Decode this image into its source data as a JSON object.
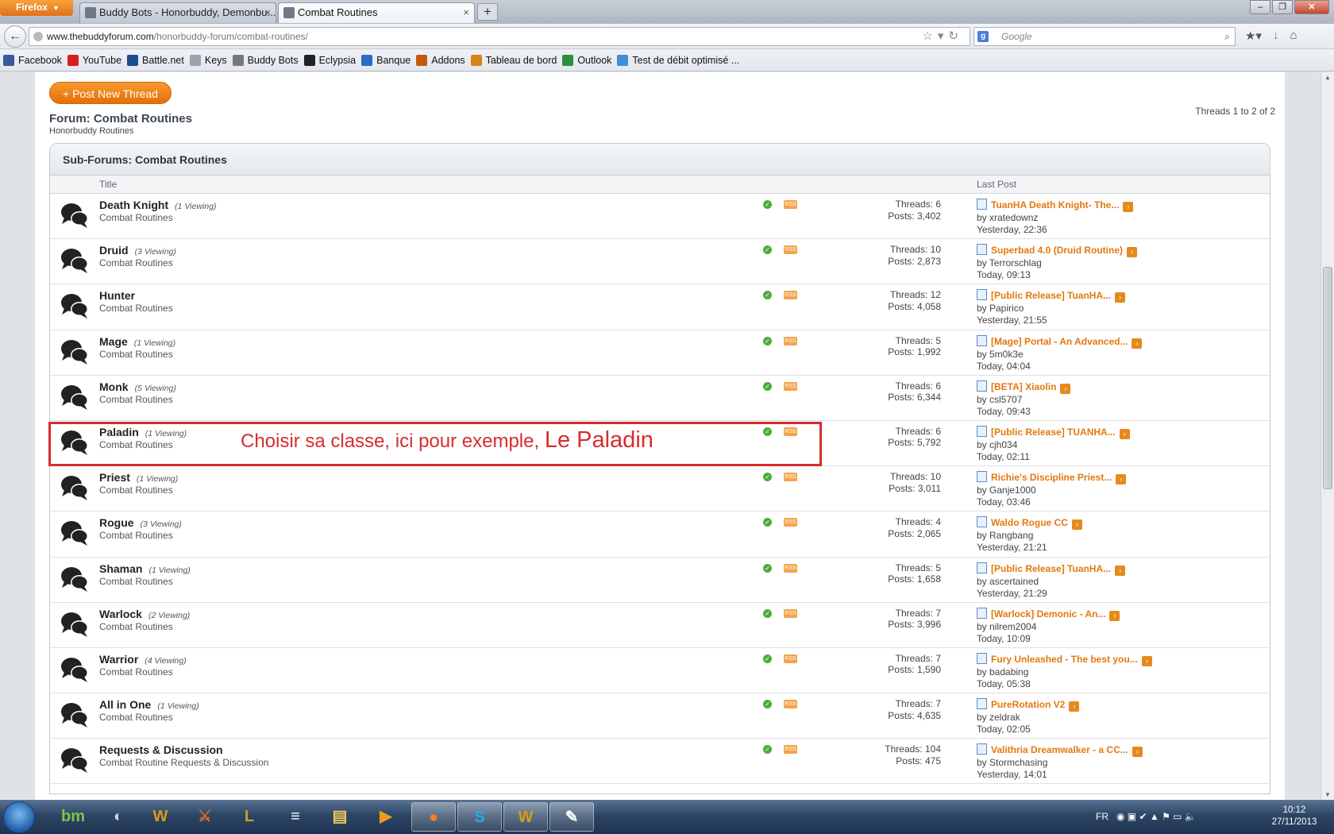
{
  "browser": {
    "menu_label": "Firefox",
    "tabs": [
      {
        "label": "Buddy Bots - Honorbuddy, Demonbu..."
      },
      {
        "label": "Combat Routines"
      }
    ],
    "url_host": "www.thebuddyforum.com",
    "url_path": "/honorbuddy-forum/combat-routines/",
    "search_placeholder": "Google",
    "bookmarks": [
      {
        "label": "Facebook",
        "color": "#3b5998"
      },
      {
        "label": "YouTube",
        "color": "#d81f1f"
      },
      {
        "label": "Battle.net",
        "color": "#1e4d8c"
      },
      {
        "label": "Keys",
        "color": "#9aa3ae"
      },
      {
        "label": "Buddy Bots",
        "color": "#777777"
      },
      {
        "label": "Eclypsia",
        "color": "#222222"
      },
      {
        "label": "Banque",
        "color": "#2a6bc9"
      },
      {
        "label": "Addons",
        "color": "#c25b10"
      },
      {
        "label": "Tableau de bord",
        "color": "#d8821b"
      },
      {
        "label": "Outlook",
        "color": "#2d8f3a"
      },
      {
        "label": "Test de débit optimisé ...",
        "color": "#3c8ed6"
      }
    ]
  },
  "page": {
    "post_button": "+ Post New Thread",
    "forum_title": "Forum: Combat Routines",
    "forum_subtitle": "Honorbuddy Routines",
    "thread_count": "Threads 1 to 2 of 2",
    "subforum_header": "Sub-Forums: Combat Routines",
    "col_title": "Title",
    "col_last_post": "Last Post",
    "annotation": "Choisir sa classe, ici pour exemple,",
    "annotation_emph": "Le Paladin",
    "rows": [
      {
        "name": "Death Knight",
        "viewing": "(1 Viewing)",
        "desc": "Combat Routines",
        "threads": "Threads: 6",
        "posts": "Posts: 3,402",
        "last_title": "TuanHA Death Knight- The...",
        "last_by": "by xratedownz",
        "last_time": "Yesterday, 22:36"
      },
      {
        "name": "Druid",
        "viewing": "(3 Viewing)",
        "desc": "Combat Routines",
        "threads": "Threads: 10",
        "posts": "Posts: 2,873",
        "last_title": "Superbad 4.0 (Druid Routine)",
        "last_by": "by Terrorschlag",
        "last_time": "Today, 09:13"
      },
      {
        "name": "Hunter",
        "viewing": "",
        "desc": "Combat Routines",
        "threads": "Threads: 12",
        "posts": "Posts: 4,058",
        "last_title": "[Public Release] TuanHA...",
        "last_by": "by Papirico",
        "last_time": "Yesterday, 21:55"
      },
      {
        "name": "Mage",
        "viewing": "(1 Viewing)",
        "desc": "Combat Routines",
        "threads": "Threads: 5",
        "posts": "Posts: 1,992",
        "last_title": "[Mage] Portal - An Advanced...",
        "last_by": "by 5m0k3e",
        "last_time": "Today, 04:04"
      },
      {
        "name": "Monk",
        "viewing": "(5 Viewing)",
        "desc": "Combat Routines",
        "threads": "Threads: 6",
        "posts": "Posts: 6,344",
        "last_title": "[BETA] Xiaolin",
        "last_by": "by csl5707",
        "last_time": "Today, 09:43"
      },
      {
        "name": "Paladin",
        "viewing": "(1 Viewing)",
        "desc": "Combat Routines",
        "threads": "Threads: 6",
        "posts": "Posts: 5,792",
        "last_title": "[Public Release] TUANHA...",
        "last_by": "by cjh034",
        "last_time": "Today, 02:11"
      },
      {
        "name": "Priest",
        "viewing": "(1 Viewing)",
        "desc": "Combat Routines",
        "threads": "Threads: 10",
        "posts": "Posts: 3,011",
        "last_title": "Richie's Discipline Priest...",
        "last_by": "by Ganje1000",
        "last_time": "Today, 03:46"
      },
      {
        "name": "Rogue",
        "viewing": "(3 Viewing)",
        "desc": "Combat Routines",
        "threads": "Threads: 4",
        "posts": "Posts: 2,065",
        "last_title": "Waldo Rogue CC",
        "last_by": "by Rangbang",
        "last_time": "Yesterday, 21:21"
      },
      {
        "name": "Shaman",
        "viewing": "(1 Viewing)",
        "desc": "Combat Routines",
        "threads": "Threads: 5",
        "posts": "Posts: 1,658",
        "last_title": "[Public Release] TuanHA...",
        "last_by": "by ascertained",
        "last_time": "Yesterday, 21:29"
      },
      {
        "name": "Warlock",
        "viewing": "(2 Viewing)",
        "desc": "Combat Routines",
        "threads": "Threads: 7",
        "posts": "Posts: 3,996",
        "last_title": "[Warlock] Demonic - An...",
        "last_by": "by nilrem2004",
        "last_time": "Today, 10:09"
      },
      {
        "name": "Warrior",
        "viewing": "(4 Viewing)",
        "desc": "Combat Routines",
        "threads": "Threads: 7",
        "posts": "Posts: 1,590",
        "last_title": "Fury Unleashed - The best you...",
        "last_by": "by badabing",
        "last_time": "Today, 05:38"
      },
      {
        "name": "All in One",
        "viewing": "(1 Viewing)",
        "desc": "Combat Routines",
        "threads": "Threads: 7",
        "posts": "Posts: 4,635",
        "last_title": "PureRotation V2",
        "last_by": "by zeldrak",
        "last_time": "Today, 02:05"
      },
      {
        "name": "Requests & Discussion",
        "viewing": "",
        "desc": "Combat Routine Requests & Discussion",
        "threads": "Threads: 104",
        "posts": "Posts: 475",
        "last_title": "Valithria Dreamwalker - a CC...",
        "last_by": "by Stormchasing",
        "last_time": "Yesterday, 14:01"
      }
    ]
  },
  "taskbar": {
    "apps": [
      {
        "label": "bm",
        "color": "#7ac943"
      },
      {
        "label": "◐",
        "color": "#cfd6de"
      },
      {
        "label": "W",
        "color": "#d4a017"
      },
      {
        "label": "⚔",
        "color": "#e06b1f"
      },
      {
        "label": "L",
        "color": "#c9a227"
      },
      {
        "label": "≡",
        "color": "#ffffff"
      },
      {
        "label": "▤",
        "color": "#f1c95b"
      },
      {
        "label": "▶",
        "color": "#f09a1a"
      },
      {
        "label": "●",
        "color": "#ff7a1a"
      },
      {
        "label": "S",
        "color": "#28a8e0"
      },
      {
        "label": "W",
        "color": "#d4a017"
      },
      {
        "label": "✎",
        "color": "#ffffff"
      }
    ],
    "lang": "FR",
    "time": "10:12",
    "date": "27/11/2013"
  }
}
